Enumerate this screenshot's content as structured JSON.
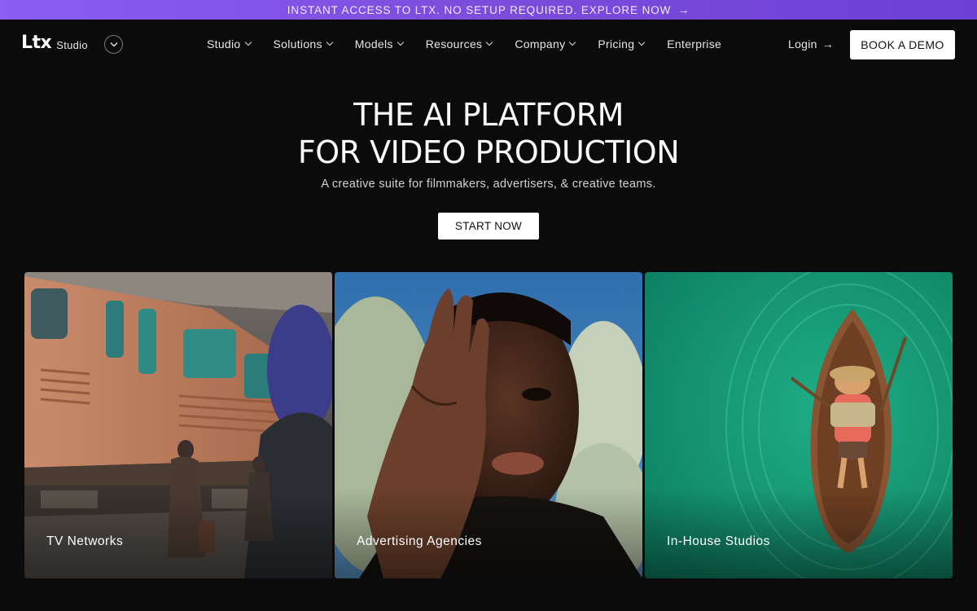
{
  "announcement": {
    "text": "INSTANT ACCESS TO LTX. NO SETUP REQUIRED. EXPLORE NOW",
    "arrow": "→"
  },
  "nav": {
    "logo_mark": "Ltx",
    "logo_sub": "Studio",
    "toggle_icon": "chevron-down-icon",
    "items": [
      {
        "label": "Studio",
        "has_dropdown": true
      },
      {
        "label": "Solutions",
        "has_dropdown": true
      },
      {
        "label": "Models",
        "has_dropdown": true
      },
      {
        "label": "Resources",
        "has_dropdown": true
      },
      {
        "label": "Company",
        "has_dropdown": true
      },
      {
        "label": "Pricing",
        "has_dropdown": true
      },
      {
        "label": "Enterprise",
        "has_dropdown": false
      }
    ],
    "login_label": "Login",
    "login_arrow": "→",
    "book_demo_label": "BOOK A DEMO"
  },
  "hero": {
    "title_line1": "THE AI PLATFORM",
    "title_line2": "FOR VIDEO PRODUCTION",
    "subtitle": "A creative suite for filmmakers, advertisers, & creative teams.",
    "cta_label": "START NOW"
  },
  "cards": [
    {
      "label": "TV Networks",
      "image": "train-platform-scene"
    },
    {
      "label": "Advertising Agencies",
      "image": "portrait-hand-over-face"
    },
    {
      "label": "In-House Studios",
      "image": "rowboat-on-green-water"
    }
  ],
  "colors": {
    "background": "#0b0b0b",
    "announce_gradient_start": "#8b5cf6",
    "announce_gradient_end": "#6d3fd6",
    "button_bg": "#ffffff",
    "card3_water": "#129a76"
  }
}
